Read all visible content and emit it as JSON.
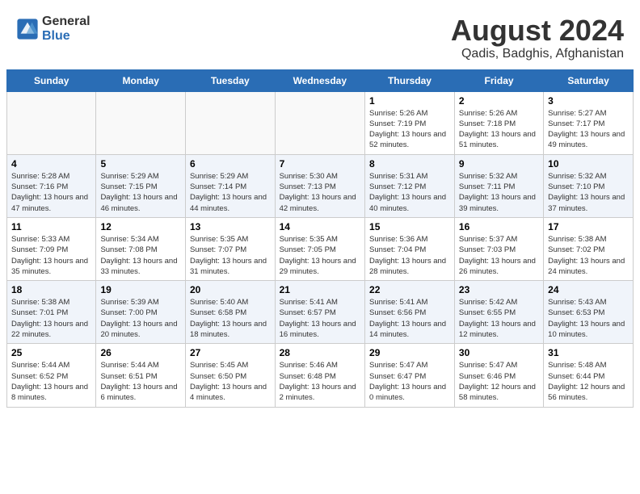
{
  "header": {
    "logo_general": "General",
    "logo_blue": "Blue",
    "month_year": "August 2024",
    "location": "Qadis, Badghis, Afghanistan"
  },
  "weekdays": [
    "Sunday",
    "Monday",
    "Tuesday",
    "Wednesday",
    "Thursday",
    "Friday",
    "Saturday"
  ],
  "weeks": [
    [
      {
        "day": "",
        "detail": ""
      },
      {
        "day": "",
        "detail": ""
      },
      {
        "day": "",
        "detail": ""
      },
      {
        "day": "",
        "detail": ""
      },
      {
        "day": "1",
        "detail": "Sunrise: 5:26 AM\nSunset: 7:19 PM\nDaylight: 13 hours\nand 52 minutes."
      },
      {
        "day": "2",
        "detail": "Sunrise: 5:26 AM\nSunset: 7:18 PM\nDaylight: 13 hours\nand 51 minutes."
      },
      {
        "day": "3",
        "detail": "Sunrise: 5:27 AM\nSunset: 7:17 PM\nDaylight: 13 hours\nand 49 minutes."
      }
    ],
    [
      {
        "day": "4",
        "detail": "Sunrise: 5:28 AM\nSunset: 7:16 PM\nDaylight: 13 hours\nand 47 minutes."
      },
      {
        "day": "5",
        "detail": "Sunrise: 5:29 AM\nSunset: 7:15 PM\nDaylight: 13 hours\nand 46 minutes."
      },
      {
        "day": "6",
        "detail": "Sunrise: 5:29 AM\nSunset: 7:14 PM\nDaylight: 13 hours\nand 44 minutes."
      },
      {
        "day": "7",
        "detail": "Sunrise: 5:30 AM\nSunset: 7:13 PM\nDaylight: 13 hours\nand 42 minutes."
      },
      {
        "day": "8",
        "detail": "Sunrise: 5:31 AM\nSunset: 7:12 PM\nDaylight: 13 hours\nand 40 minutes."
      },
      {
        "day": "9",
        "detail": "Sunrise: 5:32 AM\nSunset: 7:11 PM\nDaylight: 13 hours\nand 39 minutes."
      },
      {
        "day": "10",
        "detail": "Sunrise: 5:32 AM\nSunset: 7:10 PM\nDaylight: 13 hours\nand 37 minutes."
      }
    ],
    [
      {
        "day": "11",
        "detail": "Sunrise: 5:33 AM\nSunset: 7:09 PM\nDaylight: 13 hours\nand 35 minutes."
      },
      {
        "day": "12",
        "detail": "Sunrise: 5:34 AM\nSunset: 7:08 PM\nDaylight: 13 hours\nand 33 minutes."
      },
      {
        "day": "13",
        "detail": "Sunrise: 5:35 AM\nSunset: 7:07 PM\nDaylight: 13 hours\nand 31 minutes."
      },
      {
        "day": "14",
        "detail": "Sunrise: 5:35 AM\nSunset: 7:05 PM\nDaylight: 13 hours\nand 29 minutes."
      },
      {
        "day": "15",
        "detail": "Sunrise: 5:36 AM\nSunset: 7:04 PM\nDaylight: 13 hours\nand 28 minutes."
      },
      {
        "day": "16",
        "detail": "Sunrise: 5:37 AM\nSunset: 7:03 PM\nDaylight: 13 hours\nand 26 minutes."
      },
      {
        "day": "17",
        "detail": "Sunrise: 5:38 AM\nSunset: 7:02 PM\nDaylight: 13 hours\nand 24 minutes."
      }
    ],
    [
      {
        "day": "18",
        "detail": "Sunrise: 5:38 AM\nSunset: 7:01 PM\nDaylight: 13 hours\nand 22 minutes."
      },
      {
        "day": "19",
        "detail": "Sunrise: 5:39 AM\nSunset: 7:00 PM\nDaylight: 13 hours\nand 20 minutes."
      },
      {
        "day": "20",
        "detail": "Sunrise: 5:40 AM\nSunset: 6:58 PM\nDaylight: 13 hours\nand 18 minutes."
      },
      {
        "day": "21",
        "detail": "Sunrise: 5:41 AM\nSunset: 6:57 PM\nDaylight: 13 hours\nand 16 minutes."
      },
      {
        "day": "22",
        "detail": "Sunrise: 5:41 AM\nSunset: 6:56 PM\nDaylight: 13 hours\nand 14 minutes."
      },
      {
        "day": "23",
        "detail": "Sunrise: 5:42 AM\nSunset: 6:55 PM\nDaylight: 13 hours\nand 12 minutes."
      },
      {
        "day": "24",
        "detail": "Sunrise: 5:43 AM\nSunset: 6:53 PM\nDaylight: 13 hours\nand 10 minutes."
      }
    ],
    [
      {
        "day": "25",
        "detail": "Sunrise: 5:44 AM\nSunset: 6:52 PM\nDaylight: 13 hours\nand 8 minutes."
      },
      {
        "day": "26",
        "detail": "Sunrise: 5:44 AM\nSunset: 6:51 PM\nDaylight: 13 hours\nand 6 minutes."
      },
      {
        "day": "27",
        "detail": "Sunrise: 5:45 AM\nSunset: 6:50 PM\nDaylight: 13 hours\nand 4 minutes."
      },
      {
        "day": "28",
        "detail": "Sunrise: 5:46 AM\nSunset: 6:48 PM\nDaylight: 13 hours\nand 2 minutes."
      },
      {
        "day": "29",
        "detail": "Sunrise: 5:47 AM\nSunset: 6:47 PM\nDaylight: 13 hours\nand 0 minutes."
      },
      {
        "day": "30",
        "detail": "Sunrise: 5:47 AM\nSunset: 6:46 PM\nDaylight: 12 hours\nand 58 minutes."
      },
      {
        "day": "31",
        "detail": "Sunrise: 5:48 AM\nSunset: 6:44 PM\nDaylight: 12 hours\nand 56 minutes."
      }
    ]
  ]
}
